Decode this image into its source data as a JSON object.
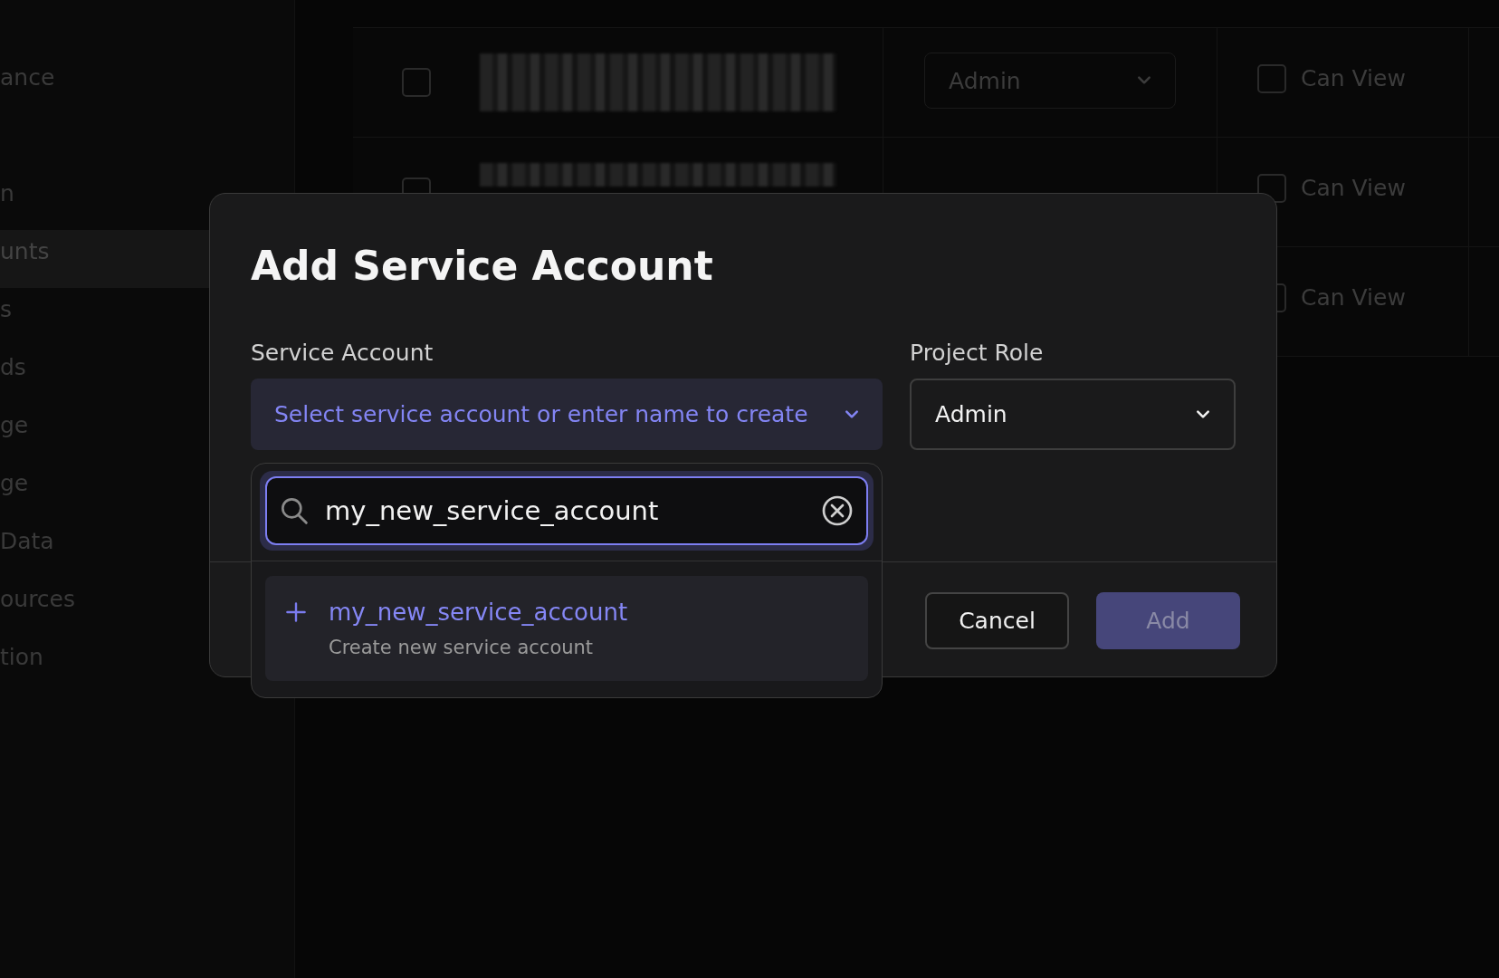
{
  "sidebar": {
    "items": [
      {
        "label": "ance",
        "selected": false
      },
      {
        "label": "n",
        "selected": false
      },
      {
        "label": "unts",
        "selected": true
      },
      {
        "label": "s",
        "selected": false
      },
      {
        "label": "ds",
        "selected": false
      },
      {
        "label": "ge",
        "selected": false
      },
      {
        "label": "ge",
        "selected": false
      },
      {
        "label": "Data",
        "selected": false
      },
      {
        "label": "ources",
        "selected": false
      },
      {
        "label": "tion",
        "selected": false
      }
    ]
  },
  "table": {
    "rows": [
      {
        "checked": false,
        "role": "Admin",
        "permission": "Can View",
        "permission_checked": false
      },
      {
        "checked": false,
        "permission": "Can View",
        "permission_checked": false
      },
      {
        "permission": "Can View",
        "permission_checked": false
      }
    ]
  },
  "dialog": {
    "title": "Add Service Account",
    "service_account": {
      "label": "Service Account",
      "placeholder": "Select service account or enter name to create",
      "expanded": true
    },
    "project_role": {
      "label": "Project Role",
      "value": "Admin"
    },
    "dropdown": {
      "search": {
        "value": "my_new_service_account"
      },
      "options": [
        {
          "title": "my_new_service_account",
          "subtitle": "Create new service account",
          "selected": true
        }
      ]
    },
    "buttons": [
      {
        "label": "Cancel",
        "kind": "secondary",
        "disabled": false
      },
      {
        "label": "Add",
        "kind": "primary",
        "disabled": true
      }
    ]
  }
}
